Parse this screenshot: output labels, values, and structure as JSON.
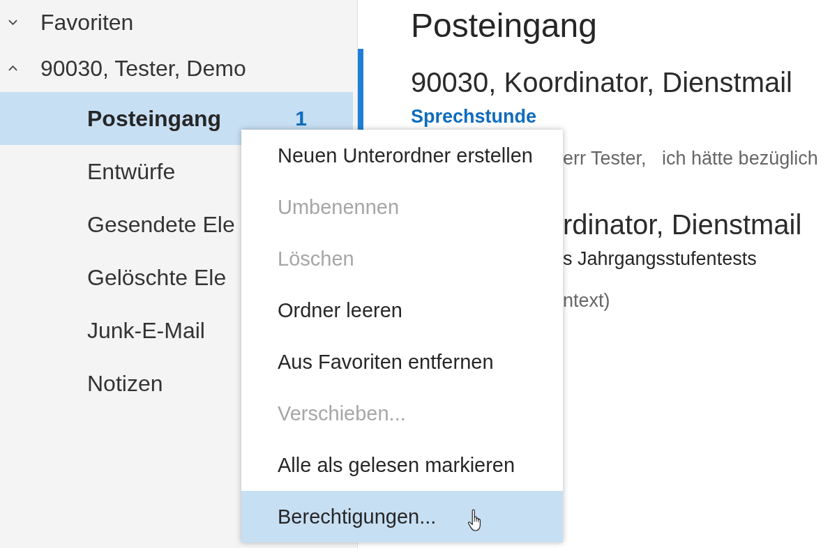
{
  "folder_pane": {
    "groups": [
      {
        "label": "Favoriten",
        "expanded": false
      },
      {
        "label": "90030, Tester, Demo",
        "expanded": true,
        "children": [
          {
            "label": "Posteingang",
            "selected": true,
            "count": "1"
          },
          {
            "label": "Entwürfe",
            "selected": false
          },
          {
            "label": "Gesendete Ele",
            "selected": false
          },
          {
            "label": "Gelöschte Ele",
            "selected": false
          },
          {
            "label": "Junk-E-Mail",
            "selected": false
          },
          {
            "label": "Notizen",
            "selected": false
          }
        ]
      }
    ]
  },
  "message_list": {
    "title": "Posteingang",
    "messages": [
      {
        "sender": "90030, Koordinator, Dienstmail",
        "subject": "Sprechstunde",
        "preview": "err Tester,   ich hätte bezüglich",
        "unread": true
      },
      {
        "sender": "rdinator, Dienstmail",
        "subject": "s Jahrgangsstufentests",
        "preview": "ntext)",
        "unread": false
      }
    ]
  },
  "context_menu": {
    "items": [
      {
        "label": "Neuen Unterordner erstellen",
        "disabled": false,
        "selected": false
      },
      {
        "label": "Umbenennen",
        "disabled": true,
        "selected": false
      },
      {
        "label": "Löschen",
        "disabled": true,
        "selected": false
      },
      {
        "label": "Ordner leeren",
        "disabled": false,
        "selected": false
      },
      {
        "label": "Aus Favoriten entfernen",
        "disabled": false,
        "selected": false
      },
      {
        "label": "Verschieben...",
        "disabled": true,
        "selected": false
      },
      {
        "label": "Alle als gelesen markieren",
        "disabled": false,
        "selected": false
      },
      {
        "label": "Berechtigungen...",
        "disabled": false,
        "selected": true
      }
    ]
  }
}
